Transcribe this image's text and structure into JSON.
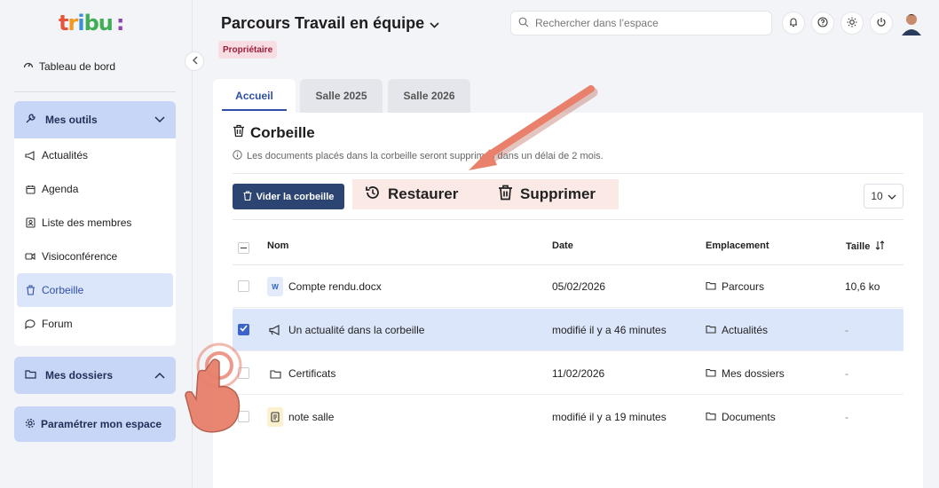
{
  "logo": [
    "t",
    "r",
    "i",
    "bu",
    ":"
  ],
  "sidebar": {
    "dashboard": "Tableau de bord",
    "tools": "Mes outils",
    "items": [
      {
        "label": "Actualités",
        "icon": "megaphone-icon",
        "glyph": "✉"
      },
      {
        "label": "Agenda",
        "icon": "calendar-icon",
        "glyph": "▦"
      },
      {
        "label": "Liste des membres",
        "icon": "members-icon",
        "glyph": "☷"
      },
      {
        "label": "Visioconférence",
        "icon": "video-icon",
        "glyph": "▭"
      },
      {
        "label": "Corbeille",
        "icon": "trash-icon",
        "glyph": "🗑"
      },
      {
        "label": "Forum",
        "icon": "forum-icon",
        "glyph": "◌"
      }
    ],
    "active_item": "Corbeille",
    "folders": "Mes dossiers",
    "settings": "Paramétrer mon espace"
  },
  "header": {
    "title": "Parcours Travail en équipe",
    "badge": "Propriétaire",
    "search_placeholder": "Rechercher dans l’espace"
  },
  "tabs": [
    "Accueil",
    "Salle 2025",
    "Salle 2026"
  ],
  "trash": {
    "title": "Corbeille",
    "info": "Les documents placés dans la corbeille seront supprimés dans un délai de 2 mois.",
    "empty_button": "Vider la corbeille",
    "restore": "Restaurer",
    "delete": "Supprimer",
    "per_page": "10"
  },
  "table": {
    "headers": {
      "name": "Nom",
      "date": "Date",
      "location": "Emplacement",
      "size": "Taille"
    },
    "rows": [
      {
        "name": "Compte rendu.docx",
        "date": "05/02/2026",
        "location": "Parcours",
        "size": "10,6 ko",
        "type": "word",
        "badge": "W",
        "selected": false
      },
      {
        "name": "Un actualité dans la corbeille",
        "date": "modifié il y a 46 minutes",
        "location": "Actualités",
        "size": "-",
        "type": "news",
        "badge": "",
        "selected": true
      },
      {
        "name": "Certificats",
        "date": "11/02/2026",
        "location": "Mes dossiers",
        "size": "-",
        "type": "folder",
        "badge": "",
        "selected": false
      },
      {
        "name": "note salle",
        "date": "modifié il y a 19 minutes",
        "location": "Documents",
        "size": "-",
        "type": "note",
        "badge": "",
        "selected": false
      }
    ]
  },
  "colors": {
    "accent": "#2f4fa8",
    "primary_button": "#2c4472",
    "nav_highlight": "#c7d6f7",
    "badge_bg": "#f8dde2",
    "annotation": "#e8806b"
  }
}
